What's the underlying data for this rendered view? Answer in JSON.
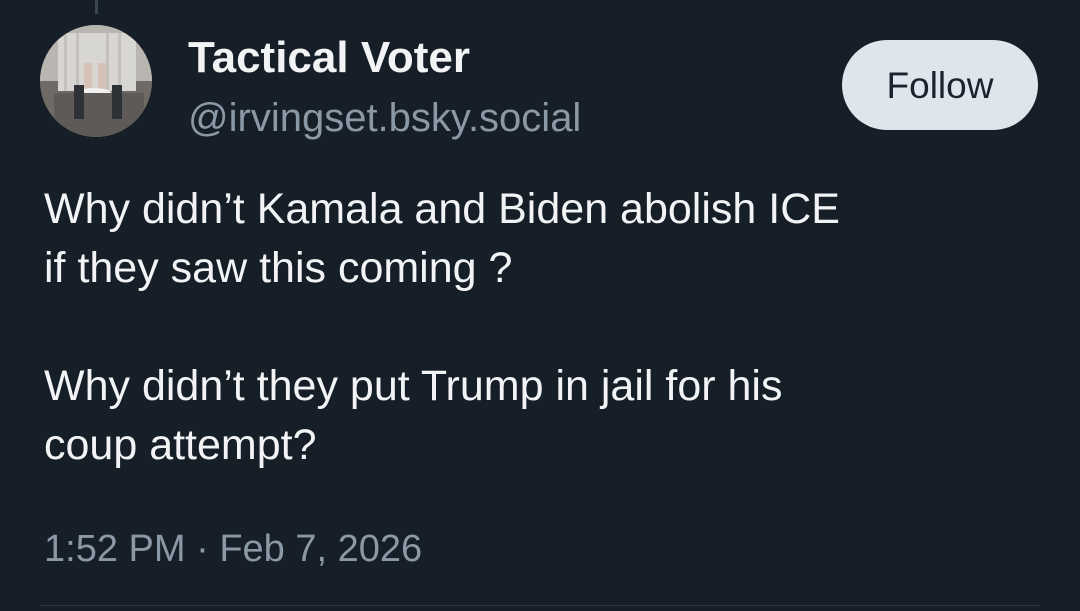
{
  "post": {
    "author": {
      "display_name": "Tactical Voter",
      "handle": "@irvingset.bsky.social"
    },
    "follow_label": "Follow",
    "paragraphs": [
      {
        "lines": [
          "Why didn’t Kamala and Biden abolish ICE",
          "if they saw this coming ?"
        ]
      },
      {
        "lines": [
          "Why didn’t they put Trump in jail for his",
          "coup attempt?"
        ]
      }
    ],
    "meta": {
      "time": "1:52 PM",
      "separator": "·",
      "date": "Feb 7, 2026"
    }
  },
  "theme": {
    "background": "#161e27",
    "text": "#f1f3f5",
    "muted": "#8b98a5",
    "follow_button_bg": "#dfe5ec"
  },
  "icons": {
    "avatar": "avatar-photo"
  }
}
